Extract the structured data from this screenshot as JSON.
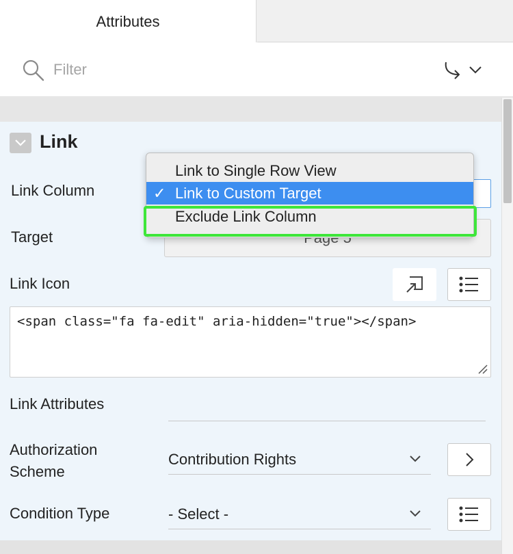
{
  "tabs": {
    "attributes": "Attributes"
  },
  "filter": {
    "placeholder": "Filter"
  },
  "section": {
    "title": "Link"
  },
  "fields": {
    "link_column": {
      "label": "Link Column"
    },
    "target": {
      "label": "Target",
      "value": "Page 5"
    },
    "link_icon": {
      "label": "Link Icon",
      "value": "<span class=\"fa fa-edit\" aria-hidden=\"true\"></span>"
    },
    "link_attributes": {
      "label": "Link Attributes",
      "value": ""
    },
    "authorization_scheme": {
      "label": "Authorization Scheme",
      "value": "Contribution Rights"
    },
    "condition_type": {
      "label": "Condition Type",
      "value": "- Select -"
    }
  },
  "dropdown": {
    "options": [
      {
        "label": "Link to Single Row View",
        "selected": false
      },
      {
        "label": "Link to Custom Target",
        "selected": true
      },
      {
        "label": "Exclude Link Column",
        "selected": false,
        "highlighted": true
      }
    ],
    "check_glyph": "✓"
  },
  "colors": {
    "selection_blue": "#3d8ef0",
    "highlight_green": "#3ee63a",
    "panel_bg": "#eef5fb"
  },
  "icons": [
    "search-icon",
    "go-to-icon",
    "chevron-down-icon",
    "collapse-chevron-icon",
    "icon-picker-icon",
    "list-icon",
    "chevron-right-icon",
    "resize-grip-icon"
  ]
}
